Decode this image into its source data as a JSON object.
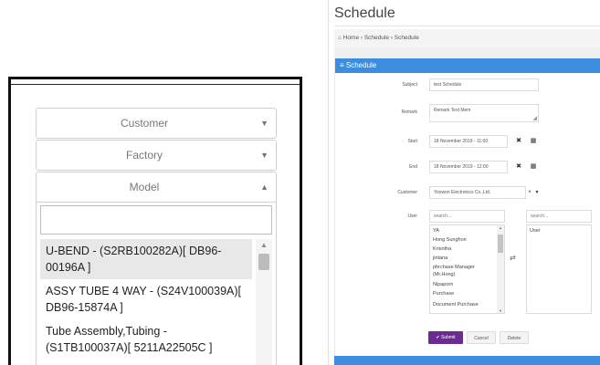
{
  "left": {
    "dropdowns": [
      {
        "label": "Customer",
        "caret": "▼"
      },
      {
        "label": "Factory",
        "caret": "▼"
      },
      {
        "label": "Model",
        "caret": "▲"
      }
    ],
    "search_placeholder": "",
    "options": [
      "U-BEND - (S2RB100282A)[ DB96-00196A ]",
      "ASSY TUBE 4 WAY - (S24V100039A)[ DB96-15874A ]",
      "Tube Assembly,Tubing - (S1TB100037A)[ 5211A22505C ]"
    ]
  },
  "right": {
    "title": "Schedule",
    "breadcrumb": "⌂ Home › Schedule › Schedule",
    "box_title": "≡ Schedule",
    "fields": {
      "subject": {
        "label": "Subject",
        "value": "test Schedule"
      },
      "remark": {
        "label": "Remark",
        "value": "Remark Test Mem"
      },
      "start": {
        "label": "Start",
        "value": "18 November 2019 - 11:00"
      },
      "end": {
        "label": "End",
        "value": "18 November 2019 - 12:00"
      },
      "customer": {
        "label": "Customer",
        "value": "Yoowon Electronics Co.,Ltd."
      },
      "user": {
        "label": "User"
      }
    },
    "user_search_placeholder": "search...",
    "selected_search_placeholder": "search...",
    "available_users": [
      "YA",
      "Hong Sunghon",
      "Krisntha",
      "jintana",
      "phrchase Manager",
      "(Mr.Hong)",
      "Nipaporn",
      "Purchase",
      "Document Purchase"
    ],
    "selected_users": [
      "User"
    ],
    "buttons": {
      "submit": "✔ Submit",
      "cancel": "Cancel",
      "delete": "Delete"
    },
    "icons": {
      "clear": "✖",
      "calendar": "▦",
      "swap": "⇄"
    }
  }
}
